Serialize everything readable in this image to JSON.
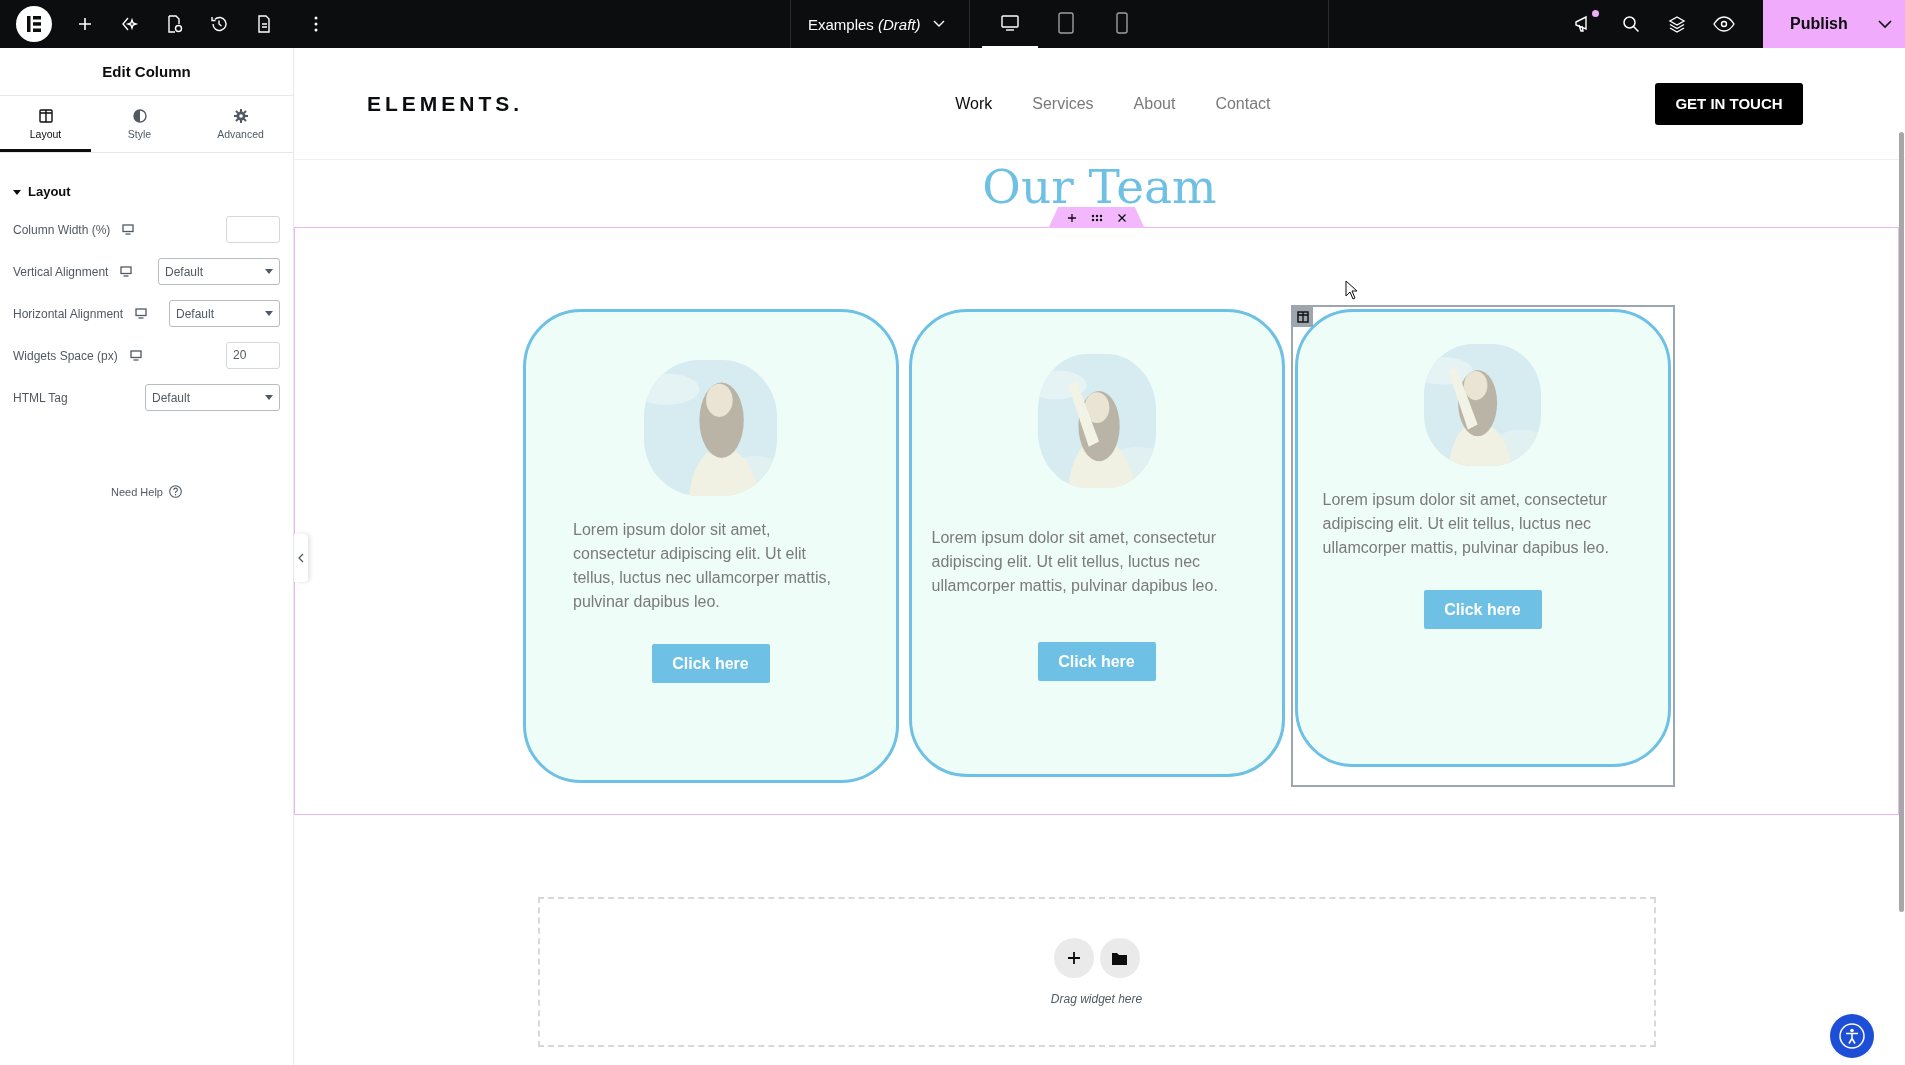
{
  "top_bar": {
    "document_title": "Examples",
    "document_status": "(Draft)",
    "notification": true,
    "publish": "Publish",
    "devices": [
      {
        "kind": "desktop",
        "selected": true
      },
      {
        "kind": "tablet",
        "selected": false
      },
      {
        "kind": "mobile",
        "selected": false
      }
    ]
  },
  "panel": {
    "title": "Edit Column",
    "tabs": [
      {
        "kind": "layout",
        "label": "Layout",
        "selected": true
      },
      {
        "kind": "style",
        "label": "Style",
        "selected": false
      },
      {
        "kind": "advanced",
        "label": "Advanced",
        "selected": false
      }
    ],
    "section": {
      "title": "Layout",
      "expanded": true
    },
    "controls": [
      {
        "kind": "number",
        "label": "Column Width (%)",
        "responsive": true
      },
      {
        "kind": "select",
        "label": "Vertical Alignment",
        "responsive": true,
        "value": "Default"
      },
      {
        "kind": "select",
        "label": "Horizontal Alignment",
        "responsive": true,
        "value": "Default"
      },
      {
        "kind": "number",
        "label": "Widgets Space (px)",
        "responsive": true,
        "value": "20"
      },
      {
        "kind": "select",
        "label": "HTML Tag",
        "responsive": false,
        "value": "Default"
      }
    ],
    "need_help": "Need Help"
  },
  "site": {
    "logo": "ELEMENTS.",
    "nav": [
      {
        "label": "Work",
        "selected": true
      },
      {
        "label": "Services",
        "selected": false
      },
      {
        "label": "About",
        "selected": false
      },
      {
        "label": "Contact",
        "selected": false
      }
    ],
    "cta": "GET IN TOUCH"
  },
  "heading": "Our Team",
  "cards": [
    {
      "text": "Lorem ipsum dolor sit amet, consectetur adipiscing elit. Ut elit tellus, luctus nec ullamcorper mattis, pulvinar dapibus leo.",
      "button": "Click here",
      "selected": false
    },
    {
      "text": "Lorem ipsum dolor sit amet, consectetur adipiscing elit. Ut elit tellus, luctus nec ullamcorper mattis, pulvinar dapibus leo.",
      "button": "Click here",
      "selected": false
    },
    {
      "text": "Lorem ipsum dolor sit amet, consectetur adipiscing elit. Ut elit tellus, luctus nec ullamcorper mattis, pulvinar dapibus leo.",
      "button": "Click here",
      "selected": true
    }
  ],
  "drop_zone": {
    "hint": "Drag widget here"
  }
}
